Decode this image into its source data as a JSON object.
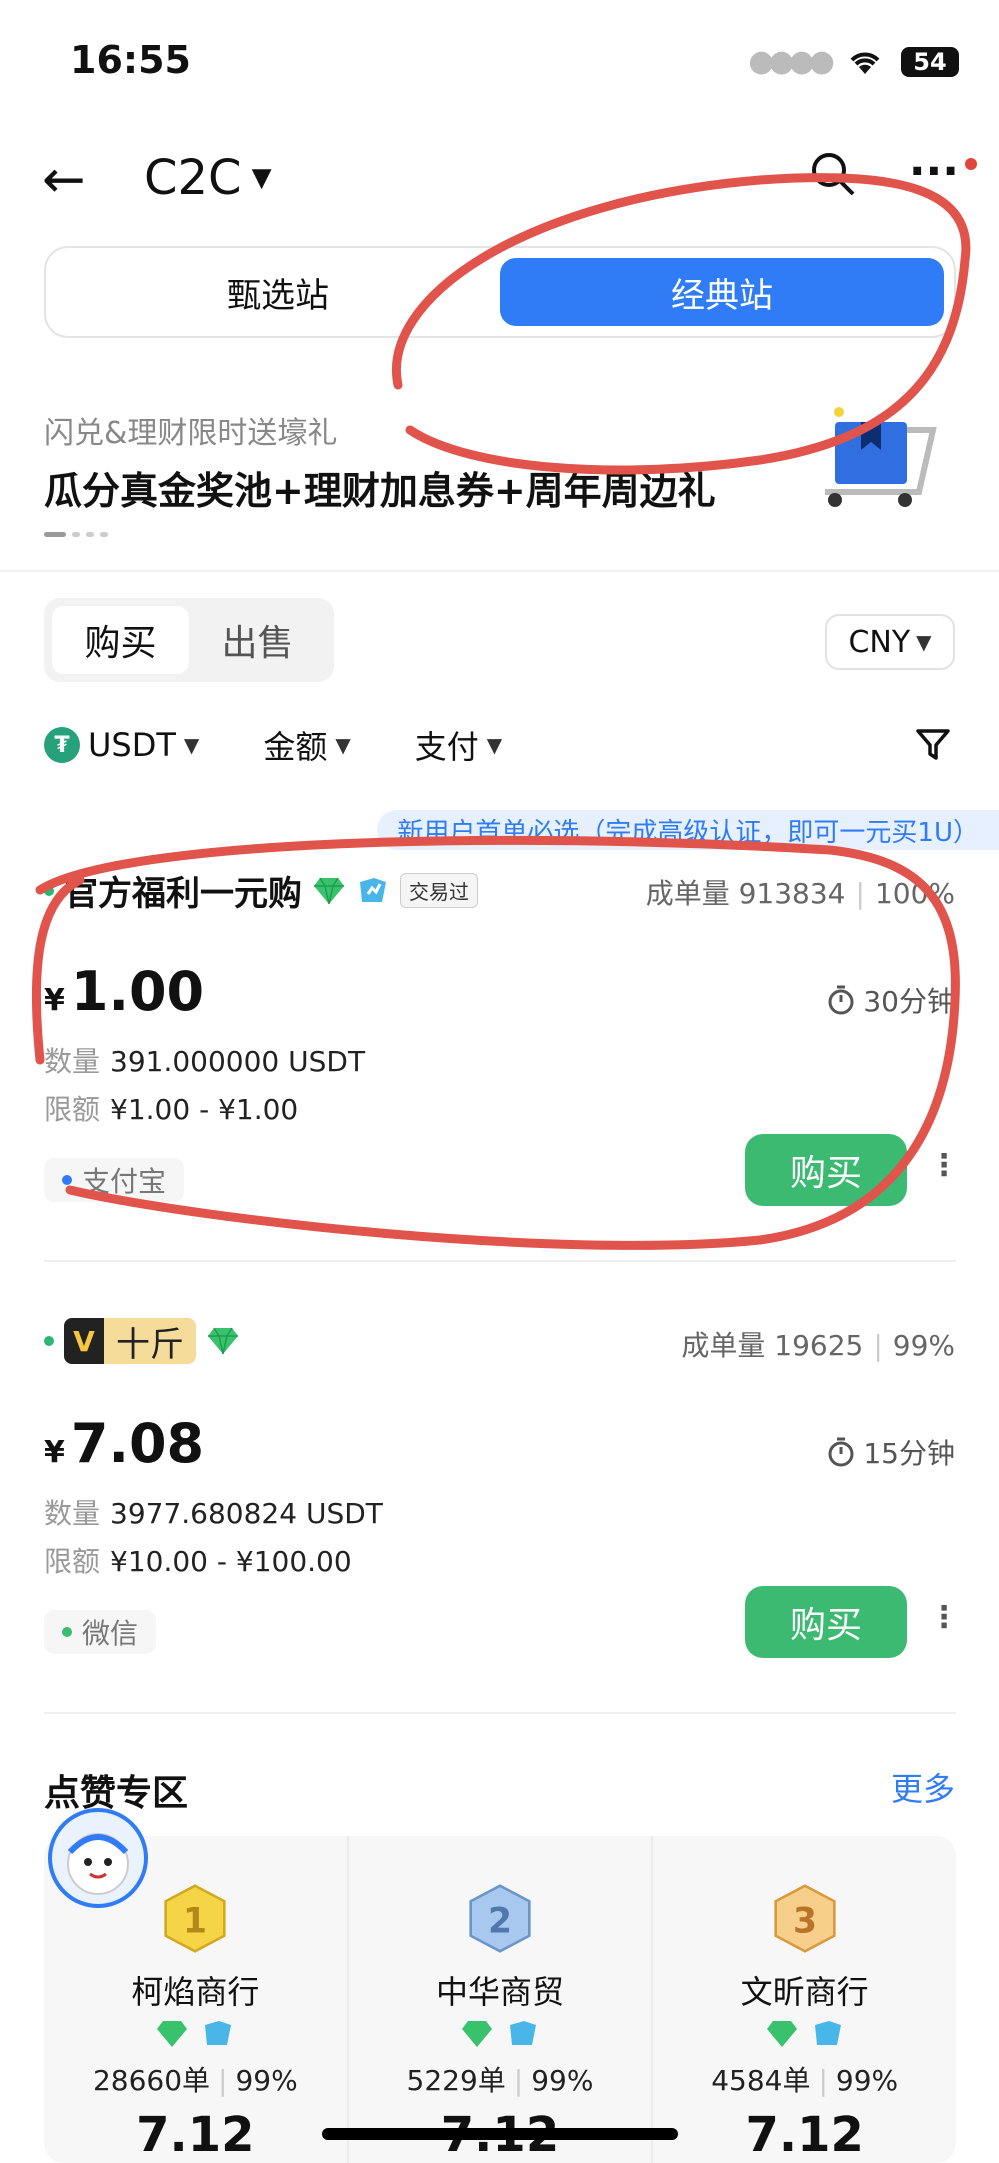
{
  "status": {
    "time": "16:55",
    "battery": "54"
  },
  "nav": {
    "title": "C2C"
  },
  "station_tabs": [
    "甄选站",
    "经典站"
  ],
  "promo": {
    "subtitle": "闪兑&理财限时送壕礼",
    "title": "瓜分真金奖池+理财加息券+周年周边礼"
  },
  "trade_tabs": [
    "购买",
    "出售"
  ],
  "currency": "CNY",
  "filters": {
    "coin": "USDT",
    "amount": "金额",
    "payment": "支付"
  },
  "banner": "新用户首单必选（完成高级认证，即可一元买1U）",
  "ads": [
    {
      "name": "官方福利一元购",
      "traded_tag": "交易过",
      "stats_label": "成单量",
      "orders": "913834",
      "rate": "100%",
      "currency_symbol": "¥",
      "price": "1.00",
      "time": "30分钟",
      "qty_label": "数量",
      "qty": "391.000000 USDT",
      "limit_label": "限额",
      "limit": "¥1.00 - ¥1.00",
      "payment": "支付宝",
      "payment_color": "#2f7cf6",
      "buy": "购买"
    },
    {
      "badge_letter": "V",
      "name": "十斤",
      "stats_label": "成单量",
      "orders": "19625",
      "rate": "99%",
      "currency_symbol": "¥",
      "price": "7.08",
      "time": "15分钟",
      "qty_label": "数量",
      "qty": "3977.680824 USDT",
      "limit_label": "限额",
      "limit": "¥10.00 - ¥100.00",
      "payment": "微信",
      "payment_color": "#3dba72",
      "buy": "购买"
    }
  ],
  "section": {
    "title": "点赞专区",
    "more": "更多"
  },
  "ranking": [
    {
      "rank": "1",
      "name": "柯焰商行",
      "orders": "28660单",
      "rate": "99%",
      "price": "7.12"
    },
    {
      "rank": "2",
      "name": "中华商贸",
      "orders": "5229单",
      "rate": "99%",
      "price": "7.12"
    },
    {
      "rank": "3",
      "name": "文昕商行",
      "orders": "4584单",
      "rate": "99%",
      "price": "7.12"
    }
  ]
}
